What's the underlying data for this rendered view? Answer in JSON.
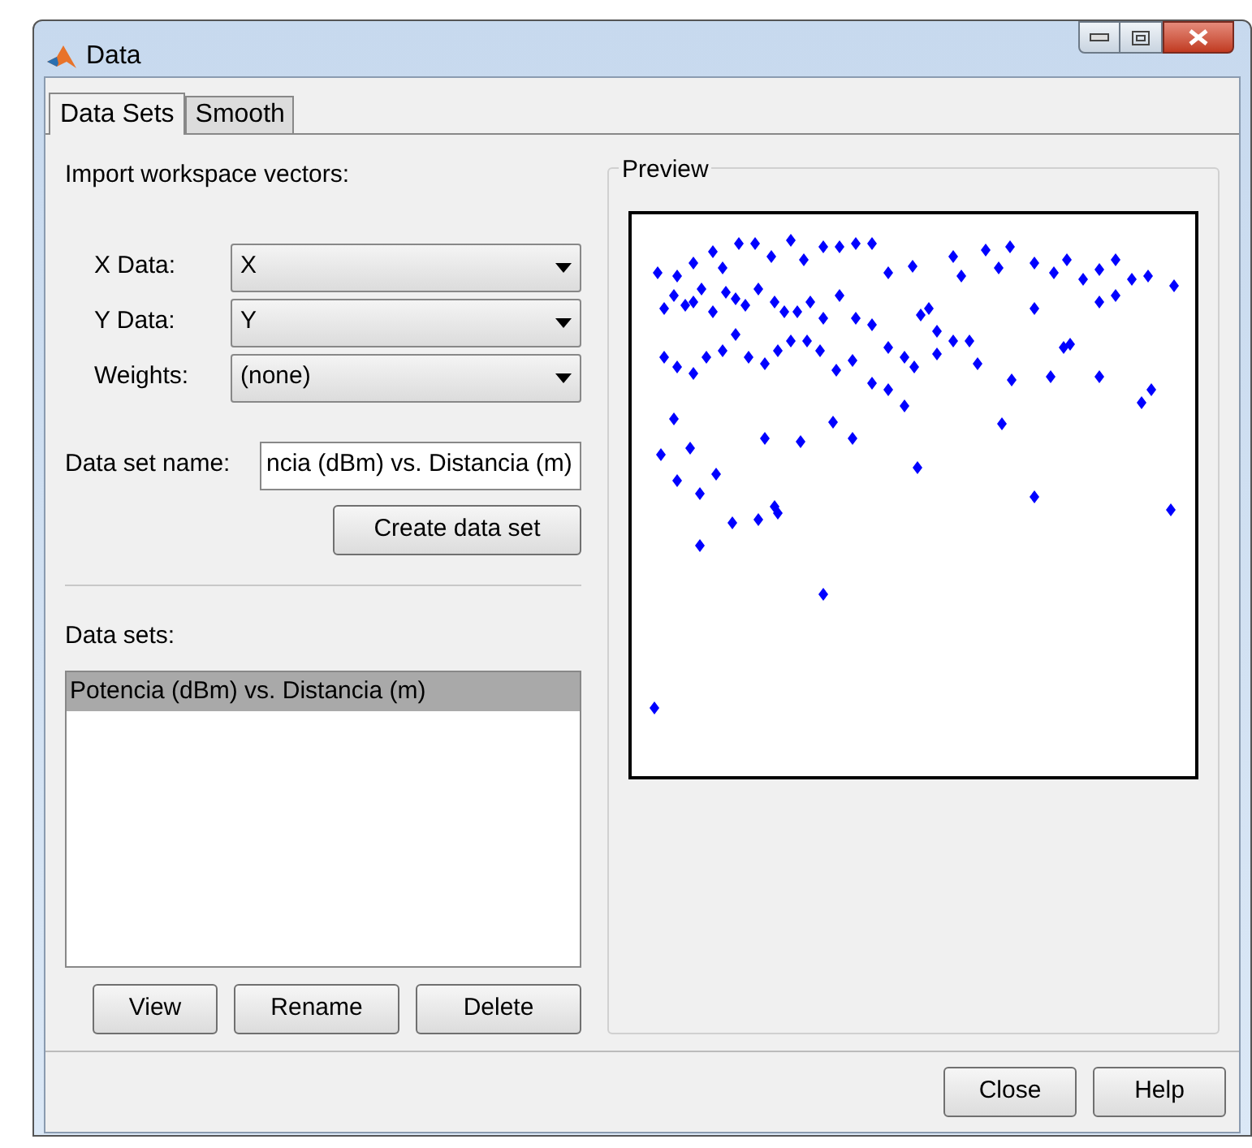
{
  "window": {
    "title": "Data"
  },
  "tabs": [
    {
      "label": "Data Sets",
      "selected": true
    },
    {
      "label": "Smooth",
      "selected": false
    }
  ],
  "import_heading": "Import workspace vectors:",
  "fields": [
    {
      "label": "X Data:",
      "value": "X"
    },
    {
      "label": "Y Data:",
      "value": "Y"
    },
    {
      "label": "Weights:",
      "value": "(none)"
    }
  ],
  "data_set_name": {
    "label": "Data set name:",
    "value": "ncia (dBm) vs. Distancia (m)"
  },
  "create_button": "Create data set",
  "data_sets": {
    "label": "Data sets:",
    "items": [
      {
        "label": "Potencia (dBm) vs. Distancia (m)",
        "selected": true
      }
    ]
  },
  "list_buttons": [
    "View",
    "Rename",
    "Delete"
  ],
  "preview": {
    "title": "Preview"
  },
  "footer_buttons": [
    "Close",
    "Help"
  ]
}
